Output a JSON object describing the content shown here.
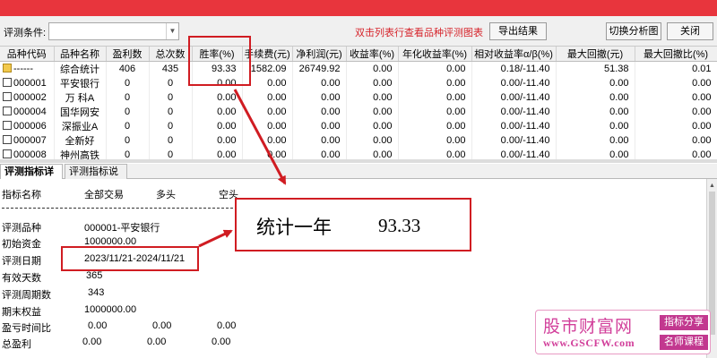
{
  "colors": {
    "accent_red": "#d01c22",
    "title_bar_red": "#e8353d",
    "watermark_pink": "#d2409b"
  },
  "toolbar": {
    "label": "评测条件:",
    "select_value": "",
    "hint": "双击列表行查看品种评测图表",
    "export_button": "导出结果",
    "switch_button": "切换分析图",
    "close_button": "关闭"
  },
  "table": {
    "headers": [
      "品种代码",
      "品种名称",
      "盈利数",
      "总次数",
      "胜率(%)",
      "手续费(元)",
      "净利润(元)",
      "收益率(%)",
      "年化收益率(%)",
      "相对收益率α/β(%)",
      "最大回撤(元)",
      "最大回撤比(%)"
    ],
    "rows": [
      {
        "icon": "folder-icon",
        "cells": [
          "------",
          "综合统计",
          "406",
          "435",
          "93.33",
          "1582.09",
          "26749.92",
          "0.00",
          "0.00",
          "0.18/-11.40",
          "51.38",
          "0.01"
        ]
      },
      {
        "icon": "document-icon",
        "cells": [
          "000001",
          "平安银行",
          "0",
          "0",
          "0.00",
          "0.00",
          "0.00",
          "0.00",
          "0.00",
          "0.00/-11.40",
          "0.00",
          "0.00"
        ]
      },
      {
        "icon": "document-icon",
        "cells": [
          "000002",
          "万 科A",
          "0",
          "0",
          "0.00",
          "0.00",
          "0.00",
          "0.00",
          "0.00",
          "0.00/-11.40",
          "0.00",
          "0.00"
        ]
      },
      {
        "icon": "document-icon",
        "cells": [
          "000004",
          "国华网安",
          "0",
          "0",
          "0.00",
          "0.00",
          "0.00",
          "0.00",
          "0.00",
          "0.00/-11.40",
          "0.00",
          "0.00"
        ]
      },
      {
        "icon": "document-icon",
        "cells": [
          "000006",
          "深振业A",
          "0",
          "0",
          "0.00",
          "0.00",
          "0.00",
          "0.00",
          "0.00",
          "0.00/-11.40",
          "0.00",
          "0.00"
        ]
      },
      {
        "icon": "document-icon",
        "cells": [
          "000007",
          "全新好",
          "0",
          "0",
          "0.00",
          "0.00",
          "0.00",
          "0.00",
          "0.00",
          "0.00/-11.40",
          "0.00",
          "0.00"
        ]
      },
      {
        "icon": "document-icon",
        "cells": [
          "000008",
          "神州高铁",
          "0",
          "0",
          "0.00",
          "0.00",
          "0.00",
          "0.00",
          "0.00",
          "0.00/-11.40",
          "0.00",
          "0.00"
        ]
      }
    ]
  },
  "tabs": [
    {
      "label": "评测指标详情",
      "active": true
    },
    {
      "label": "评测指标说明",
      "active": false
    }
  ],
  "detail": {
    "headers": [
      "指标名称",
      "全部交易",
      "多头",
      "空头"
    ],
    "items": [
      {
        "label": "评测品种",
        "values": [
          "000001-平安银行"
        ]
      },
      {
        "label": "初始资金",
        "values": [
          "1000000.00"
        ]
      },
      {
        "label": "评测日期",
        "values": [
          "2023/11/21-2024/11/21"
        ]
      },
      {
        "label": "有效天数",
        "values": [
          "365"
        ]
      },
      {
        "label": "评测周期数",
        "values": [
          "343"
        ]
      },
      {
        "label": "期末权益",
        "values": [
          "1000000.00"
        ]
      },
      {
        "label": "盈亏时间比",
        "values": [
          "0.00",
          "0.00",
          "0.00"
        ]
      },
      {
        "label": "总盈利",
        "values": [
          "0.00",
          "0.00",
          "0.00"
        ]
      }
    ]
  },
  "callout": {
    "text": "统计一年",
    "value": "93.33"
  },
  "watermark": {
    "title": "股市财富网",
    "url": "www.GSCFW.com",
    "tag1": "指标分享",
    "tag2": "名师课程"
  }
}
